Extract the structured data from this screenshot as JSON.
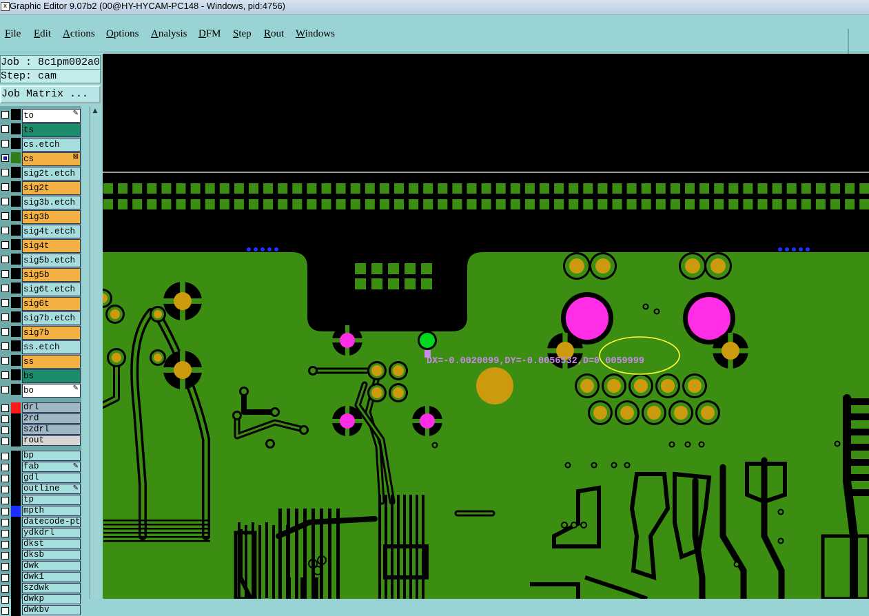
{
  "window": {
    "title": "Graphic Editor 9.07b2 (00@HY-HYCAM-PC148 - Windows, pid:4756)"
  },
  "menu": [
    "File",
    "Edit",
    "Actions",
    "Options",
    "Analysis",
    "DFM",
    "Step",
    "Rout",
    "Windows"
  ],
  "job": {
    "label": "Job : 8c1pm002a0",
    "step": "Step: cam",
    "matrix_button": "Job Matrix ..."
  },
  "colors": {
    "board_green": "#3c8e12",
    "pad_gold": "#cb9a0e",
    "pad_magenta": "#ff2ee6",
    "highlight": "#ffff33",
    "measure_text": "#c78ce8"
  },
  "layers": [
    {
      "name": "to",
      "bg": "#ffffff",
      "mark": "✎"
    },
    {
      "name": "ts",
      "bg": "#1c8c6a"
    },
    {
      "name": "cs.etch",
      "bg": "#a6dede"
    },
    {
      "name": "cs",
      "bg": "#f3b144",
      "swatch": "#2f7d1b",
      "checked": true,
      "mark": "⊠"
    },
    {
      "name": "sig2t.etch",
      "bg": "#a6dede"
    },
    {
      "name": "sig2t",
      "bg": "#f3b144"
    },
    {
      "name": "sig3b.etch",
      "bg": "#a6dede"
    },
    {
      "name": "sig3b",
      "bg": "#f3b144"
    },
    {
      "name": "sig4t.etch",
      "bg": "#a6dede"
    },
    {
      "name": "sig4t",
      "bg": "#f3b144"
    },
    {
      "name": "sig5b.etch",
      "bg": "#a6dede"
    },
    {
      "name": "sig5b",
      "bg": "#f3b144"
    },
    {
      "name": "sig6t.etch",
      "bg": "#a6dede"
    },
    {
      "name": "sig6t",
      "bg": "#f3b144"
    },
    {
      "name": "sig7b.etch",
      "bg": "#a6dede"
    },
    {
      "name": "sig7b",
      "bg": "#f3b144"
    },
    {
      "name": "ss.etch",
      "bg": "#a6dede"
    },
    {
      "name": "ss",
      "bg": "#f3b144"
    },
    {
      "name": "bs",
      "bg": "#1c8c6a"
    },
    {
      "name": "bo",
      "bg": "#ffffff",
      "mark": "✎"
    },
    {
      "name": "drl",
      "bg": "#9fb7c2",
      "swatch": "#ff1a1a"
    },
    {
      "name": "2rd",
      "bg": "#9fb7c2"
    },
    {
      "name": "szdrl",
      "bg": "#9fb7c2"
    },
    {
      "name": "rout",
      "bg": "#d6d6d6"
    },
    {
      "name": "bp",
      "bg": "#a6dede"
    },
    {
      "name": "fab",
      "bg": "#a6dede",
      "mark": "✎"
    },
    {
      "name": "gdl",
      "bg": "#a6dede"
    },
    {
      "name": "outline",
      "bg": "#a6dede",
      "mark": "✎"
    },
    {
      "name": "tp",
      "bg": "#a6dede"
    },
    {
      "name": "mpth",
      "bg": "#a6dede",
      "swatch": "#1a2eff"
    },
    {
      "name": "datecode-ptop",
      "bg": "#a6dede"
    },
    {
      "name": "ydkdrl",
      "bg": "#a6dede"
    },
    {
      "name": "dkst",
      "bg": "#a6dede"
    },
    {
      "name": "dksb",
      "bg": "#a6dede"
    },
    {
      "name": "dwk",
      "bg": "#a6dede"
    },
    {
      "name": "dwk1",
      "bg": "#a6dede"
    },
    {
      "name": "szdwk",
      "bg": "#a6dede"
    },
    {
      "name": "dwkp",
      "bg": "#a6dede"
    },
    {
      "name": "dwkbv",
      "bg": "#a6dede"
    }
  ],
  "measurement": {
    "text": "DX=-0.0020099,DY=-0.0056532,D=0.0059999"
  }
}
